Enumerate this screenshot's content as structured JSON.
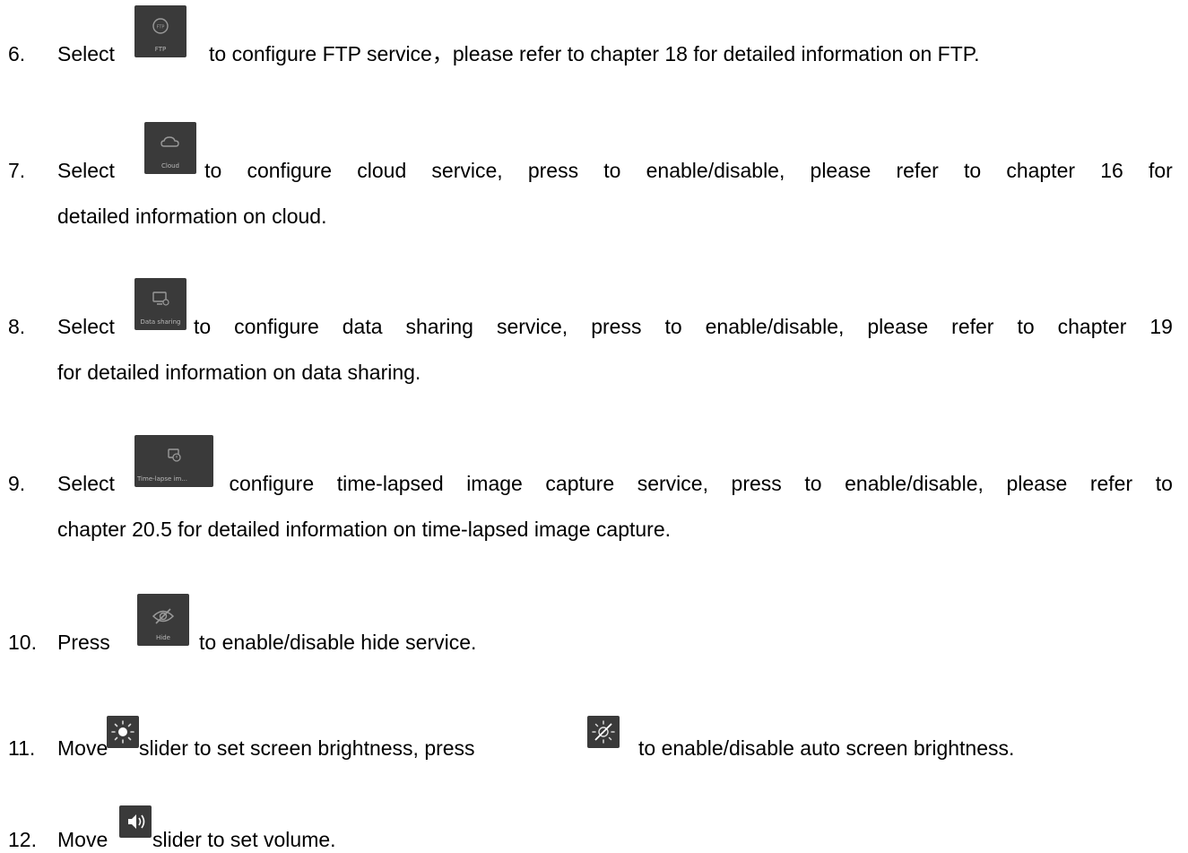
{
  "items": [
    {
      "number": "6.",
      "lines": [
        [
          "Select",
          "to configure FTP service，please refer to chapter 18 for detailed information on FTP."
        ]
      ],
      "icon": {
        "name": "ftp-icon",
        "caption": "FTP"
      }
    },
    {
      "number": "7.",
      "lines": [
        [
          "Select",
          "to",
          "configure",
          "cloud",
          "service,",
          "press",
          "to",
          "enable/disable,",
          "please",
          "refer",
          "to",
          "chapter",
          "16",
          "for"
        ],
        [
          "detailed information on cloud."
        ]
      ],
      "icon": {
        "name": "cloud-icon",
        "caption": "Cloud"
      }
    },
    {
      "number": "8.",
      "lines": [
        [
          "Select",
          "to",
          "configure",
          "data",
          "sharing",
          "service,",
          "press",
          "to",
          "enable/disable,",
          "please",
          "refer",
          "to",
          "chapter",
          "19"
        ],
        [
          "for detailed information on data sharing."
        ]
      ],
      "icon": {
        "name": "data-sharing-icon",
        "caption": "Data sharing"
      }
    },
    {
      "number": "9.",
      "lines": [
        [
          "Select",
          "configure",
          "time-lapsed",
          "image",
          "capture",
          "service,",
          "press",
          "to",
          "enable/disable,",
          "please",
          "refer",
          "to"
        ],
        [
          "chapter 20.5 for detailed information on time-lapsed image capture."
        ]
      ],
      "icon": {
        "name": "time-lapse-icon",
        "caption": "Time-lapse im..."
      }
    },
    {
      "number": "10.",
      "lines": [
        [
          "Press",
          "to enable/disable hide service."
        ]
      ],
      "icon": {
        "name": "hide-icon",
        "caption": "Hide"
      }
    },
    {
      "number": "11.",
      "lines": [
        [
          "Move",
          "slider to set screen brightness, press",
          "to enable/disable auto screen brightness."
        ]
      ],
      "icon": {
        "name": "brightness-icon",
        "caption": ""
      },
      "icon2": {
        "name": "auto-brightness-icon",
        "caption": ""
      }
    },
    {
      "number": "12.",
      "lines": [
        [
          "Move",
          "slider to set volume."
        ]
      ],
      "icon": {
        "name": "volume-icon",
        "caption": ""
      }
    }
  ],
  "colors": {
    "text": "#000000",
    "tile": "#3a3a3a",
    "tile_icon": "#9a9a9a"
  }
}
